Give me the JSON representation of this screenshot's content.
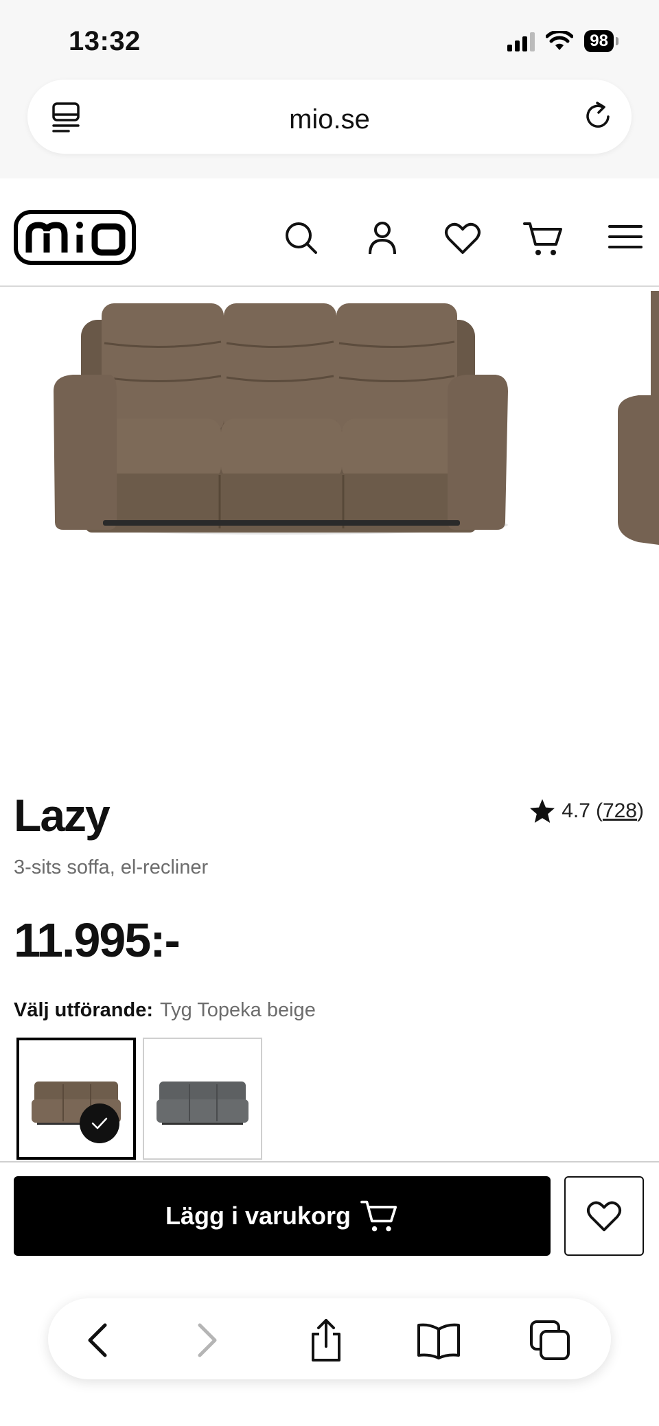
{
  "status_bar": {
    "time": "13:32",
    "battery": "98"
  },
  "browser": {
    "url": "mio.se"
  },
  "site": {
    "logo_text": "mio"
  },
  "product": {
    "title": "Lazy",
    "rating": "4.7",
    "review_count_open": "(",
    "review_count": "728",
    "review_count_close": ")",
    "subtitle": "3-sits soffa, el-recliner",
    "price": "11.995:-",
    "variant_label": "Välj utförande:",
    "variant_value": "Tyg Topeka beige",
    "variants": [
      {
        "name": "Tyg Topeka beige",
        "color": "#6e5d4c",
        "selected": true
      },
      {
        "name": "Grå",
        "color": "#5d6062",
        "selected": false
      }
    ]
  },
  "actions": {
    "add_to_cart_label": "Lägg i varukorg"
  },
  "colors": {
    "sofa_brown": "#6e5d4c",
    "sofa_grey": "#5d6062",
    "button_black": "#000000"
  }
}
